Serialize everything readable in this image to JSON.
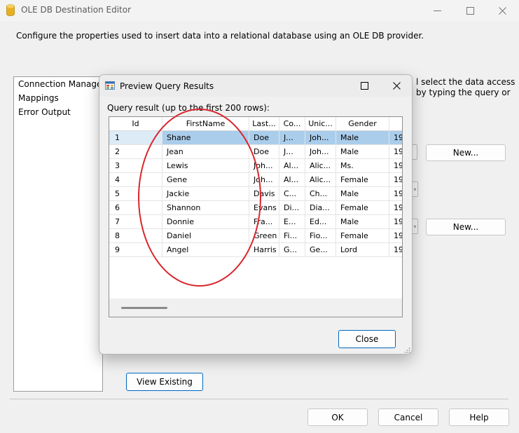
{
  "main_window": {
    "title": "OLE DB Destination Editor",
    "description": "Configure the properties used to insert data into a relational database using an OLE DB provider.",
    "nav_items": [
      "Connection Manager",
      "Mappings",
      "Error Output"
    ],
    "partial_text_line1": "l select the data access",
    "partial_text_line2": "by typing the query or",
    "new_button_1": "New...",
    "new_button_2": "New...",
    "view_existing_button": "View Existing",
    "ok_button": "OK",
    "cancel_button": "Cancel",
    "help_button": "Help"
  },
  "dialog": {
    "title": "Preview Query Results",
    "caption": "Query result (up to the first 200 rows):",
    "close_button": "Close",
    "selection_color": "#aacdec",
    "annotation_color": "#d9262c",
    "grid": {
      "columns": [
        "Id",
        "FirstName",
        "Last...",
        "Co...",
        "Unic...",
        "Gender",
        ""
      ],
      "rows": [
        [
          "1",
          "Shane",
          "Doe",
          "J...",
          "Joh...",
          "Male",
          "19"
        ],
        [
          "2",
          "Jean",
          "Doe",
          "J...",
          "Joh...",
          "Male",
          "19"
        ],
        [
          "3",
          "Lewis",
          "Joh...",
          "Al...",
          "Alic...",
          "Ms.",
          "19"
        ],
        [
          "4",
          "Gene",
          "Joh...",
          "Al...",
          "Alic...",
          "Female",
          "19"
        ],
        [
          "5",
          "Jackie",
          "Davis",
          "C...",
          "Ch...",
          "Male",
          "19"
        ],
        [
          "6",
          "Shannon",
          "Evans",
          "Di...",
          "Dia...",
          "Female",
          "19"
        ],
        [
          "7",
          "Donnie",
          "Fra...",
          "E...",
          "Ed...",
          "Male",
          "19"
        ],
        [
          "8",
          "Daniel",
          "Green",
          "Fi...",
          "Fio...",
          "Female",
          "19"
        ],
        [
          "9",
          "Angel",
          "Harris",
          "G...",
          "Ge...",
          "Lord",
          "19"
        ]
      ],
      "selected_row": 0
    }
  }
}
